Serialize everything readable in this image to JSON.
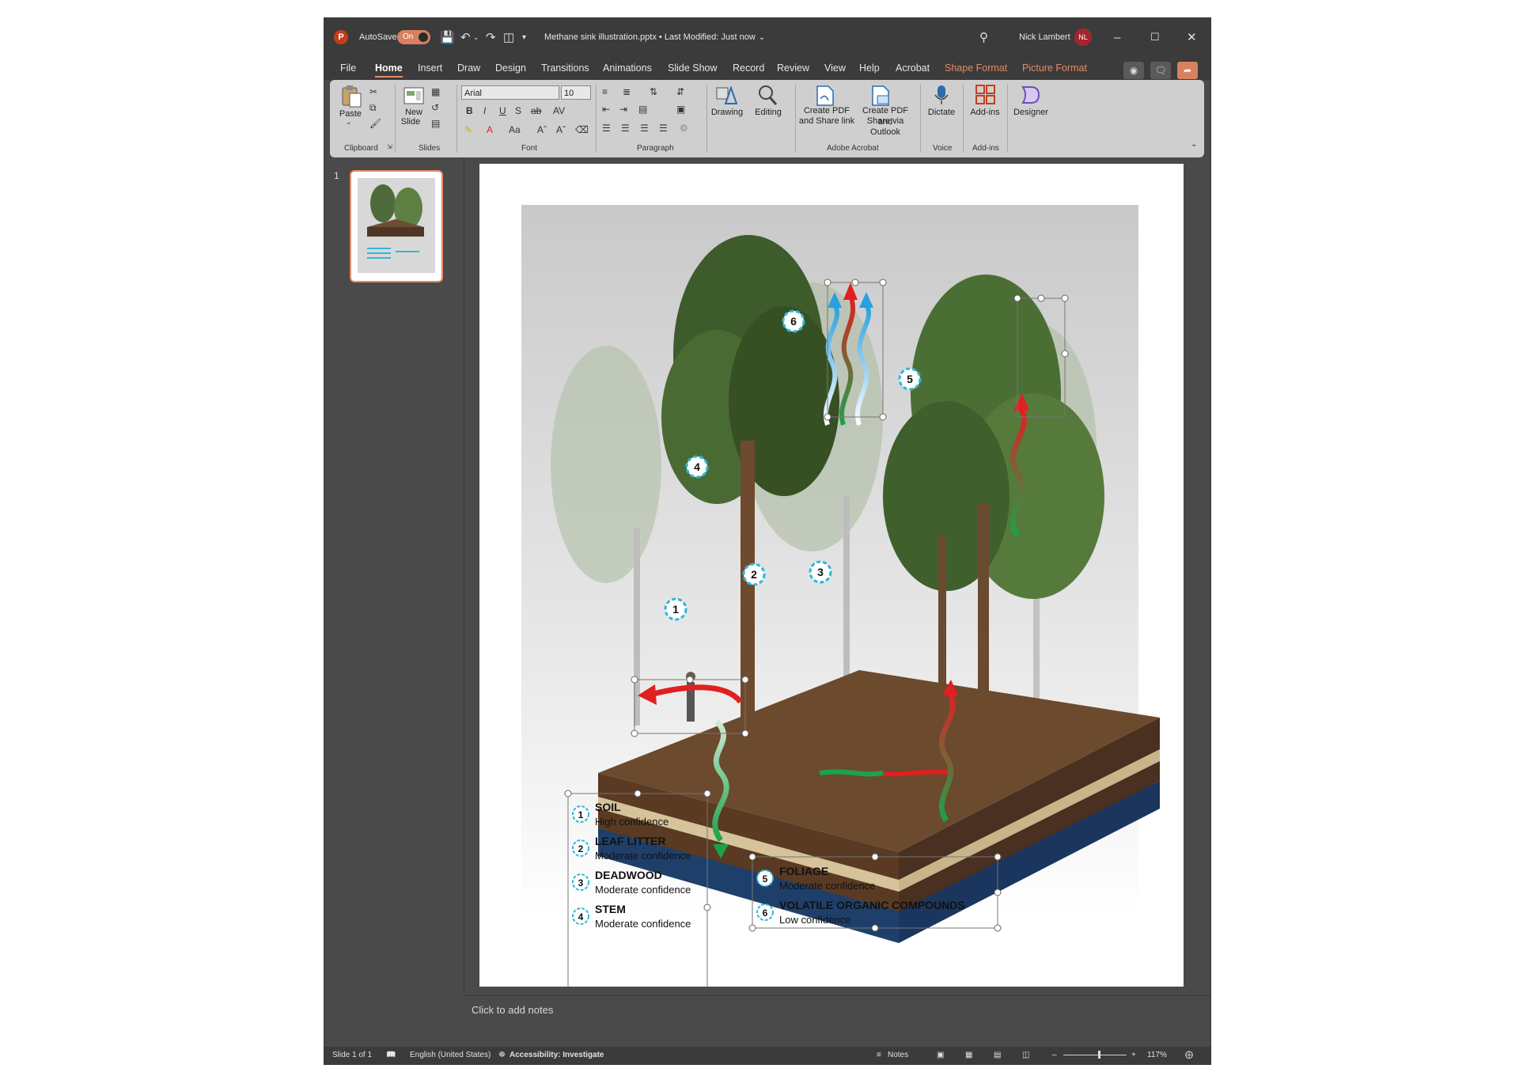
{
  "title_bar": {
    "autosave_label": "AutoSave",
    "autosave_state": "On",
    "document_title": "Methane sink illustration.pptx • Last Modified: Just now",
    "user_name": "Nick Lambert",
    "user_initials": "NL"
  },
  "menu": {
    "tabs": [
      "File",
      "Home",
      "Insert",
      "Draw",
      "Design",
      "Transitions",
      "Animations",
      "Slide Show",
      "Record",
      "Review",
      "View",
      "Help",
      "Acrobat"
    ],
    "context_tabs": [
      "Shape Format",
      "Picture Format"
    ],
    "active_tab": "Home"
  },
  "ribbon": {
    "clipboard": {
      "paste": "Paste",
      "group": "Clipboard"
    },
    "slides": {
      "new_slide_line1": "New",
      "new_slide_line2": "Slide",
      "group": "Slides"
    },
    "font": {
      "family": "Arial",
      "size": "10",
      "group": "Font"
    },
    "paragraph": {
      "group": "Paragraph"
    },
    "drawing": {
      "label": "Drawing"
    },
    "editing": {
      "label": "Editing"
    },
    "acrobat": {
      "create_pdf_line1": "Create PDF",
      "create_pdf_line2": "and Share link",
      "create_outlook_line1": "Create PDF and",
      "create_outlook_line2": "Share via Outlook",
      "group": "Adobe Acrobat"
    },
    "voice": {
      "dictate": "Dictate",
      "group": "Voice"
    },
    "addins": {
      "label": "Add-ins",
      "group": "Add-ins"
    },
    "designer": {
      "label": "Designer"
    }
  },
  "thumbnails": {
    "slide_number": "1"
  },
  "slide": {
    "markers": [
      "1",
      "2",
      "3",
      "4",
      "5",
      "6"
    ],
    "legend_left": [
      {
        "num": "1",
        "title": "SOIL",
        "subtitle": "High confidence"
      },
      {
        "num": "2",
        "title": "LEAF LITTER",
        "subtitle": "Moderate confidence"
      },
      {
        "num": "3",
        "title": "DEADWOOD",
        "subtitle": "Moderate confidence"
      },
      {
        "num": "4",
        "title": "STEM",
        "subtitle": "Moderate confidence"
      }
    ],
    "legend_right": [
      {
        "num": "5",
        "title": "FOLIAGE",
        "subtitle": "Moderate confidence"
      },
      {
        "num": "6",
        "title": "VOLATILE ORGANIC COMPOUNDS",
        "subtitle": "Low confidence"
      }
    ]
  },
  "notes": {
    "placeholder": "Click to add notes"
  },
  "status_bar": {
    "slide_info": "Slide 1 of 1",
    "language": "English (United States)",
    "accessibility": "Accessibility: Investigate",
    "notes_label": "Notes",
    "zoom": "117%"
  },
  "colors": {
    "accent": "#e58a64",
    "chrome": "#3b3b3b",
    "ribbon": "#cfcfcf",
    "canvas": "#4a4a4a"
  }
}
